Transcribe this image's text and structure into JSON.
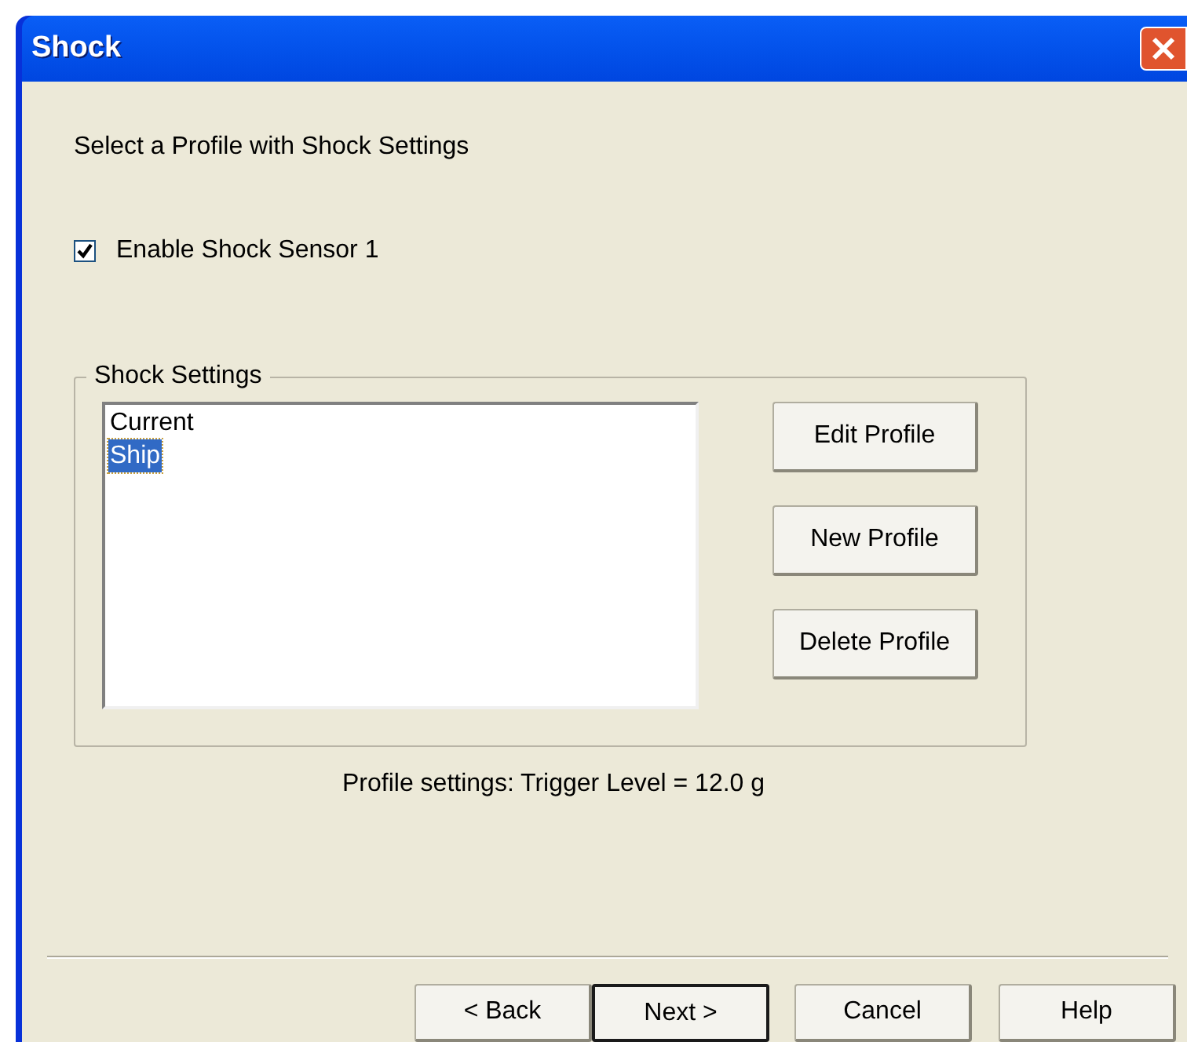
{
  "window": {
    "title": "Shock"
  },
  "prompt": "Select a Profile with Shock Settings",
  "enable_checkbox": {
    "label": "Enable Shock Sensor 1",
    "checked": true
  },
  "shock_settings": {
    "title": "Shock Settings",
    "profiles": [
      {
        "label": "Current",
        "selected": false
      },
      {
        "label": "Ship",
        "selected": true
      }
    ],
    "buttons": [
      "Edit Profile",
      "New Profile",
      "Delete Profile"
    ]
  },
  "profile_summary": "Profile settings: Trigger Level = 12.0 g",
  "footer_buttons": [
    {
      "label": "< Back",
      "default": false
    },
    {
      "label": "Next >",
      "default": true
    },
    {
      "label": "Cancel",
      "default": false
    },
    {
      "label": "Help",
      "default": false
    }
  ]
}
